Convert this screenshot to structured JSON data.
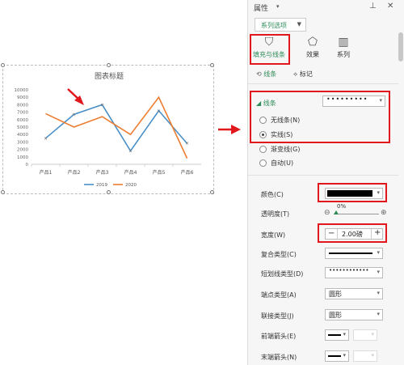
{
  "chart": {
    "title": "图表标题",
    "y_ticks": [
      "10000",
      "9000",
      "8000",
      "7000",
      "6000",
      "5000",
      "4000",
      "3000",
      "2000",
      "1000",
      "0"
    ],
    "categories": [
      "产品1",
      "产品2",
      "产品3",
      "产品4",
      "产品5",
      "产品6"
    ],
    "legend": [
      "2019",
      "2020"
    ]
  },
  "chart_data": {
    "type": "line",
    "title": "图表标题",
    "categories": [
      "产品1",
      "产品2",
      "产品3",
      "产品4",
      "产品5",
      "产品6"
    ],
    "ylim": [
      0,
      10000
    ],
    "series": [
      {
        "name": "2019",
        "values": [
          3500,
          6700,
          8000,
          1800,
          7200,
          2800
        ],
        "color": "#4a90c8"
      },
      {
        "name": "2020",
        "values": [
          6800,
          5000,
          6400,
          4000,
          9000,
          800
        ],
        "color": "#ed7d31"
      }
    ],
    "legend_position": "bottom"
  },
  "panel": {
    "title": "属性",
    "series_option": "系列选项",
    "tabs": [
      "填充与线条",
      "效果",
      "系列"
    ],
    "subtabs": [
      "线条",
      "标记"
    ],
    "section": "线条",
    "radios": [
      "无线条(N)",
      "实线(S)",
      "渐变线(G)",
      "自动(U)"
    ],
    "props": [
      "颜色(C)",
      "透明度(T)",
      "宽度(W)",
      "复合类型(C)",
      "短划线类型(D)",
      "端点类型(A)",
      "联接类型(J)",
      "前端箭头(E)",
      "末端箭头(N)"
    ],
    "transparency": "0%",
    "width_value": "2.00磅",
    "cap_value": "圆形",
    "join_value": "圆形"
  },
  "colors": {
    "accent": "#2e8b57",
    "annotation": "#e0181e"
  }
}
